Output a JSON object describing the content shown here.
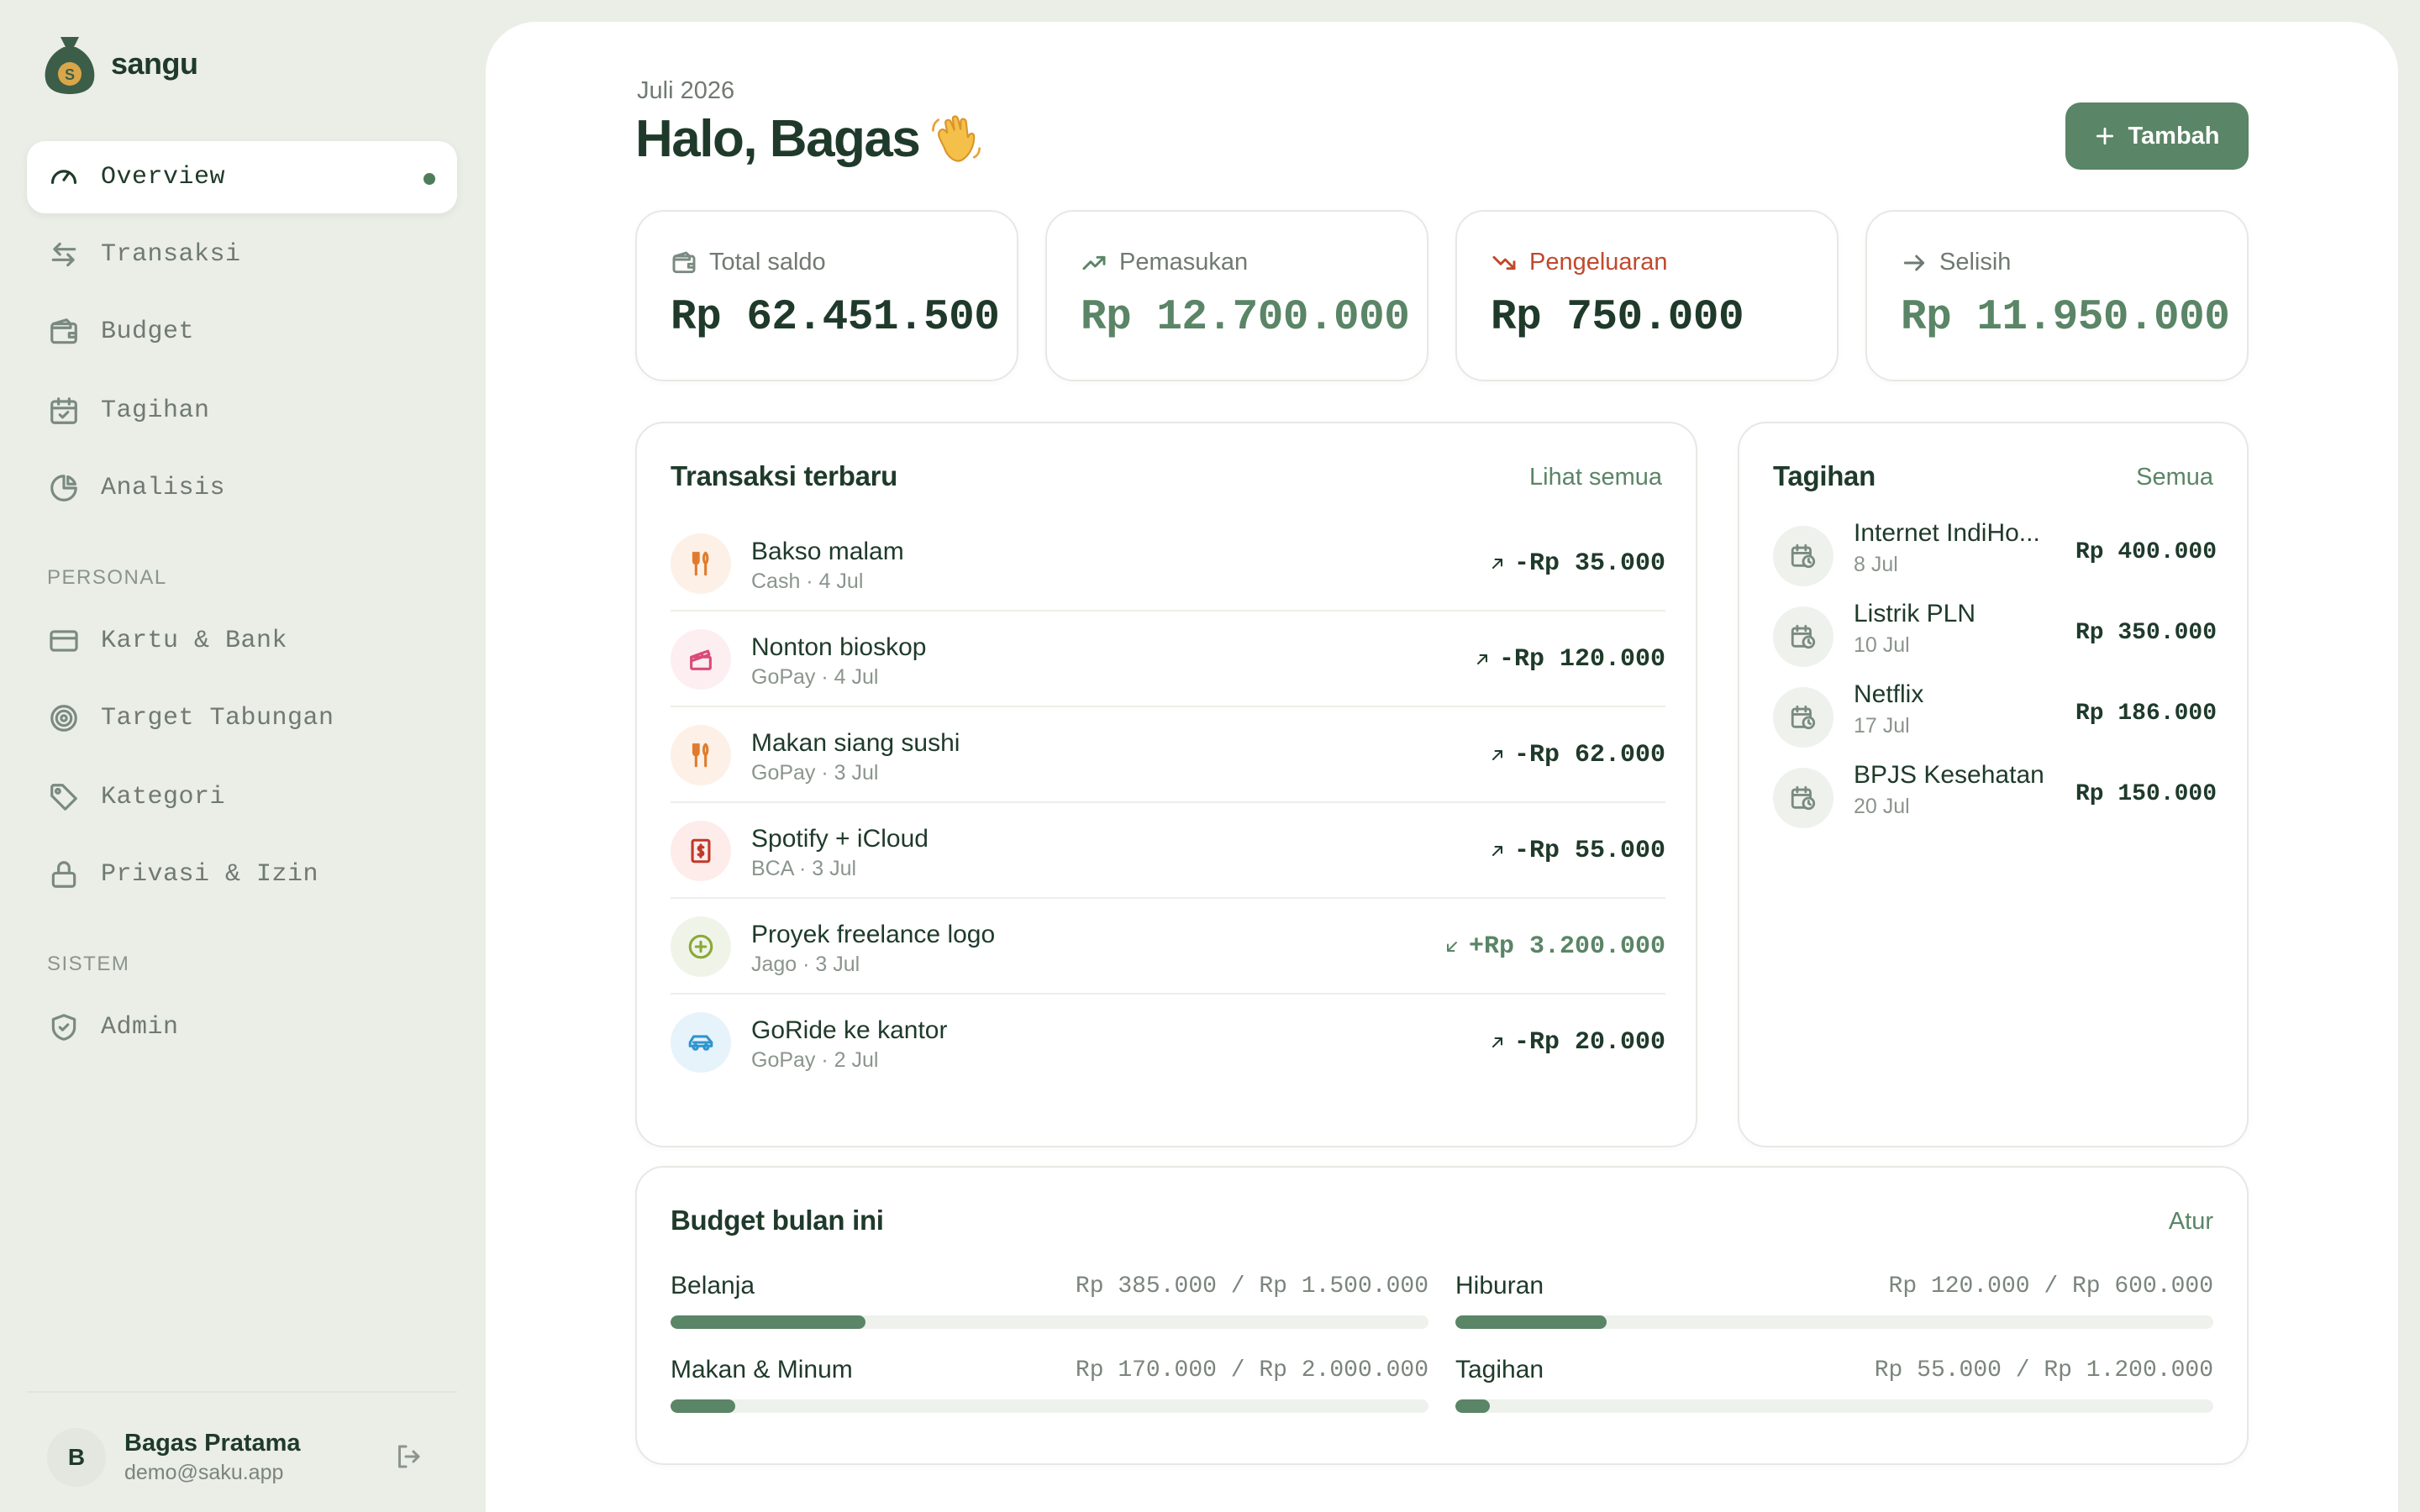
{
  "app": {
    "name": "sangu"
  },
  "colors": {
    "accent": "#5a8566",
    "text": "#1f3a2a",
    "expense": "#c0492c",
    "income": "#5a8566",
    "background": "#ebede7"
  },
  "sidebar": {
    "items": [
      {
        "label": "Overview",
        "icon": "gauge-icon",
        "active": true
      },
      {
        "label": "Transaksi",
        "icon": "transfer-arrows-icon"
      },
      {
        "label": "Budget",
        "icon": "wallet-icon"
      },
      {
        "label": "Tagihan",
        "icon": "calendar-check-icon"
      },
      {
        "label": "Analisis",
        "icon": "pie-chart-icon"
      }
    ],
    "personal_label": "PERSONAL",
    "personal": [
      {
        "label": "Kartu & Bank",
        "icon": "credit-card-icon"
      },
      {
        "label": "Target Tabungan",
        "icon": "target-icon"
      },
      {
        "label": "Kategori",
        "icon": "tag-icon"
      },
      {
        "label": "Privasi & Izin",
        "icon": "lock-icon"
      }
    ],
    "system_label": "SISTEM",
    "system": [
      {
        "label": "Admin",
        "icon": "shield-icon"
      }
    ],
    "user": {
      "initial": "B",
      "name": "Bagas Pratama",
      "email": "demo@saku.app"
    }
  },
  "header": {
    "date": "Juli 2026",
    "greeting": "Halo, Bagas",
    "add_label": "Tambah"
  },
  "stats": [
    {
      "label": "Total saldo",
      "value": "Rp 62.451.500",
      "icon": "wallet-icon"
    },
    {
      "label": "Pemasukan",
      "value": "Rp 12.700.000",
      "icon": "trend-up-icon"
    },
    {
      "label": "Pengeluaran",
      "value": "Rp 750.000",
      "icon": "trend-down-icon"
    },
    {
      "label": "Selisih",
      "value": "Rp 11.950.000",
      "icon": "arrow-right-icon"
    }
  ],
  "transactions": {
    "title": "Transaksi terbaru",
    "link": "Lihat semua",
    "rows": [
      {
        "name": "Bakso malam",
        "meta": "Cash · 4 Jul",
        "amount": "-Rp 35.000",
        "type": "expense",
        "icon": "utensils-icon"
      },
      {
        "name": "Nonton bioskop",
        "meta": "GoPay · 4 Jul",
        "amount": "-Rp 120.000",
        "type": "expense",
        "icon": "clapperboard-icon"
      },
      {
        "name": "Makan siang sushi",
        "meta": "GoPay · 3 Jul",
        "amount": "-Rp 62.000",
        "type": "expense",
        "icon": "utensils-icon"
      },
      {
        "name": "Spotify + iCloud",
        "meta": "BCA · 3 Jul",
        "amount": "-Rp 55.000",
        "type": "expense",
        "icon": "receipt-icon"
      },
      {
        "name": "Proyek freelance logo",
        "meta": "Jago · 3 Jul",
        "amount": "+Rp 3.200.000",
        "type": "income",
        "icon": "plus-circle-icon"
      },
      {
        "name": "GoRide ke kantor",
        "meta": "GoPay · 2 Jul",
        "amount": "-Rp 20.000",
        "type": "expense",
        "icon": "car-icon"
      }
    ]
  },
  "bills": {
    "title": "Tagihan",
    "link": "Semua",
    "rows": [
      {
        "name": "Internet IndiHo...",
        "date": "8 Jul",
        "amount": "Rp 400.000"
      },
      {
        "name": "Listrik PLN",
        "date": "10 Jul",
        "amount": "Rp 350.000"
      },
      {
        "name": "Netflix",
        "date": "17 Jul",
        "amount": "Rp 186.000"
      },
      {
        "name": "BPJS Kesehatan",
        "date": "20 Jul",
        "amount": "Rp 150.000"
      }
    ]
  },
  "budget": {
    "title": "Budget bulan ini",
    "link": "Atur",
    "items": [
      {
        "name": "Belanja",
        "amount": "Rp 385.000 / Rp 1.500.000",
        "progress": 0.257
      },
      {
        "name": "Hiburan",
        "amount": "Rp 120.000 / Rp 600.000",
        "progress": 0.2
      },
      {
        "name": "Makan & Minum",
        "amount": "Rp 170.000 / Rp 2.000.000",
        "progress": 0.085
      },
      {
        "name": "Tagihan",
        "amount": "Rp 55.000 / Rp 1.200.000",
        "progress": 0.046
      }
    ]
  }
}
